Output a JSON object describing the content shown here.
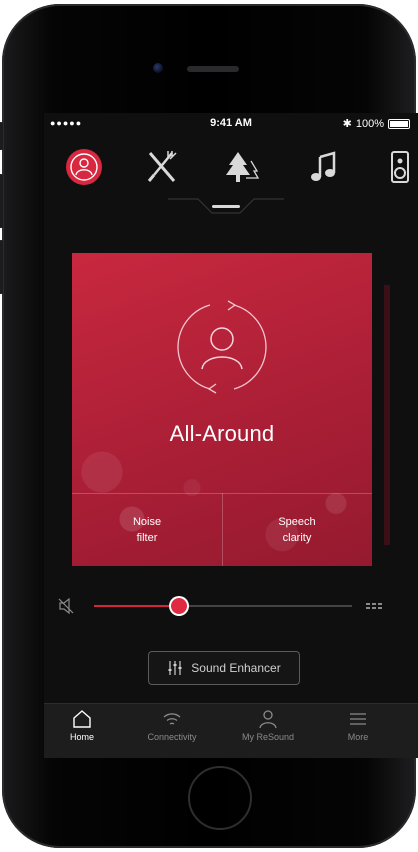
{
  "status_bar": {
    "signal": "●●●●● ",
    "time": "9:41 AM",
    "bluetooth": "✱",
    "battery": "100%"
  },
  "programs": [
    {
      "icon": "person-circle-icon",
      "active": true
    },
    {
      "icon": "fork-knife-icon",
      "active": false
    },
    {
      "icon": "trees-icon",
      "active": false
    },
    {
      "icon": "music-note-icon",
      "active": false
    },
    {
      "icon": "speaker-icon",
      "active": false
    }
  ],
  "program_card": {
    "title": "All-Around",
    "buttons": [
      {
        "line1": "Noise",
        "line2": "filter"
      },
      {
        "line1": "Speech",
        "line2": "clarity"
      }
    ],
    "color": "#c2263c"
  },
  "volume": {
    "level_fraction": 0.33,
    "accent": "#e02a44"
  },
  "sound_enhancer": {
    "label": "Sound Enhancer"
  },
  "tab_bar": {
    "tabs": [
      {
        "label": "Home",
        "icon": "house-icon",
        "active": true
      },
      {
        "label": "Connectivity",
        "icon": "wifi-icon",
        "active": false
      },
      {
        "label": "My ReSound",
        "icon": "person-icon",
        "active": false
      },
      {
        "label": "More",
        "icon": "menu-icon",
        "active": false
      }
    ]
  }
}
